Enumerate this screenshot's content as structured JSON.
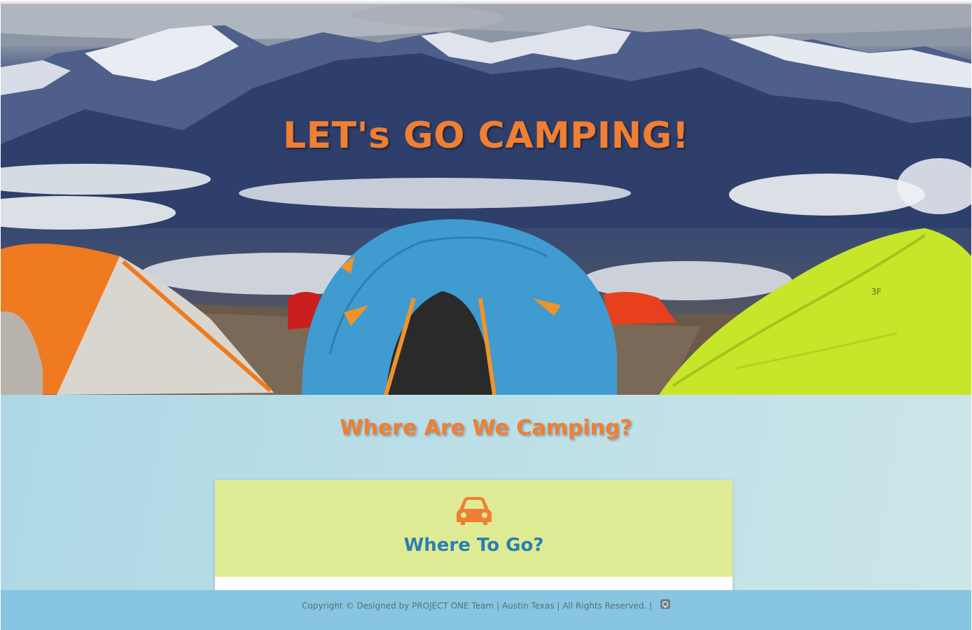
{
  "hero": {
    "title": "LET's GO CAMPING!"
  },
  "main": {
    "section_title": "Where Are We Camping?",
    "card": {
      "icon": "car-icon",
      "title": "Where To Go?"
    }
  },
  "footer": {
    "copyright": "Copyright © Designed by PROJECT ONE Team | Austin Texas | All Rights Reserved. |",
    "icon": "github-icon"
  },
  "colors": {
    "accent_orange": "#f07f33",
    "card_bg": "#dfeb94",
    "card_title_blue": "#2b7fb3",
    "footer_bg": "#87c5e2"
  }
}
